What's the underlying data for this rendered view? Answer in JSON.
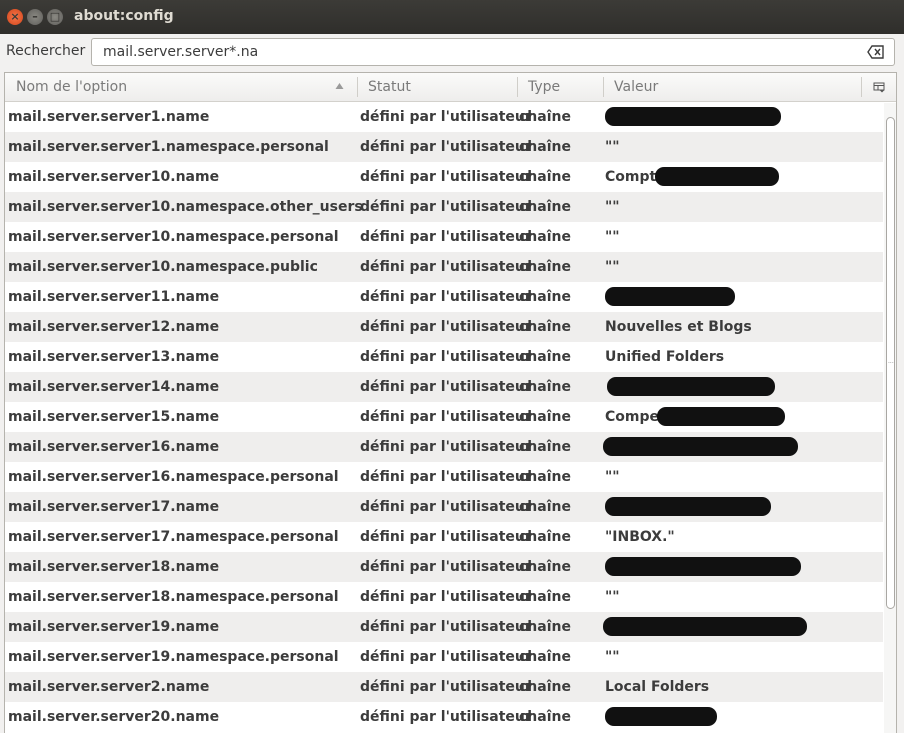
{
  "window": {
    "title": "about:config",
    "close_glyph": "×",
    "min_glyph": "–",
    "max_glyph": "□"
  },
  "search": {
    "label": "Rechercher :",
    "value": "mail.server.server*.na",
    "clear_icon": "clear-icon"
  },
  "columns": {
    "name": "Nom de l'option",
    "status": "Statut",
    "type": "Type",
    "value": "Valeur",
    "sort_icon": "triangle-up-icon",
    "picker_icon": "column-picker-icon"
  },
  "rows": [
    {
      "name": "mail.server.server1.name",
      "status": "défini par l'utilisateur",
      "type": "chaîne",
      "value": "",
      "redacted": true
    },
    {
      "name": "mail.server.server1.namespace.personal",
      "status": "défini par l'utilisateur",
      "type": "chaîne",
      "value": "\"\"",
      "redacted": false
    },
    {
      "name": "mail.server.server10.name",
      "status": "défini par l'utilisateur",
      "type": "chaîne",
      "value": "Compte",
      "redacted": true
    },
    {
      "name": "mail.server.server10.namespace.other_users",
      "status": "défini par l'utilisateur",
      "type": "chaîne",
      "value": "\"\"",
      "redacted": false
    },
    {
      "name": "mail.server.server10.namespace.personal",
      "status": "défini par l'utilisateur",
      "type": "chaîne",
      "value": "\"\"",
      "redacted": false
    },
    {
      "name": "mail.server.server10.namespace.public",
      "status": "défini par l'utilisateur",
      "type": "chaîne",
      "value": "\"\"",
      "redacted": false
    },
    {
      "name": "mail.server.server11.name",
      "status": "défini par l'utilisateur",
      "type": "chaîne",
      "value": "",
      "redacted": true
    },
    {
      "name": "mail.server.server12.name",
      "status": "défini par l'utilisateur",
      "type": "chaîne",
      "value": "Nouvelles et Blogs",
      "redacted": false
    },
    {
      "name": "mail.server.server13.name",
      "status": "défini par l'utilisateur",
      "type": "chaîne",
      "value": "Unified Folders",
      "redacted": false
    },
    {
      "name": "mail.server.server14.name",
      "status": "défini par l'utilisateur",
      "type": "chaîne",
      "value": "",
      "redacted": true
    },
    {
      "name": "mail.server.server15.name",
      "status": "défini par l'utilisateur",
      "type": "chaîne",
      "value": "Compe",
      "redacted": true
    },
    {
      "name": "mail.server.server16.name",
      "status": "défini par l'utilisateur",
      "type": "chaîne",
      "value": "",
      "redacted": true
    },
    {
      "name": "mail.server.server16.namespace.personal",
      "status": "défini par l'utilisateur",
      "type": "chaîne",
      "value": "\"\"",
      "redacted": false
    },
    {
      "name": "mail.server.server17.name",
      "status": "défini par l'utilisateur",
      "type": "chaîne",
      "value": "",
      "redacted": true
    },
    {
      "name": "mail.server.server17.namespace.personal",
      "status": "défini par l'utilisateur",
      "type": "chaîne",
      "value": "\"INBOX.\"",
      "redacted": false
    },
    {
      "name": "mail.server.server18.name",
      "status": "défini par l'utilisateur",
      "type": "chaîne",
      "value": "",
      "redacted": true
    },
    {
      "name": "mail.server.server18.namespace.personal",
      "status": "défini par l'utilisateur",
      "type": "chaîne",
      "value": "\"\"",
      "redacted": false
    },
    {
      "name": "mail.server.server19.name",
      "status": "défini par l'utilisateur",
      "type": "chaîne",
      "value": "",
      "redacted": true
    },
    {
      "name": "mail.server.server19.namespace.personal",
      "status": "défini par l'utilisateur",
      "type": "chaîne",
      "value": "\"\"",
      "redacted": false
    },
    {
      "name": "mail.server.server2.name",
      "status": "défini par l'utilisateur",
      "type": "chaîne",
      "value": "Local Folders",
      "redacted": false
    },
    {
      "name": "mail.server.server20.name",
      "status": "défini par l'utilisateur",
      "type": "chaîne",
      "value": "",
      "redacted": true
    }
  ]
}
